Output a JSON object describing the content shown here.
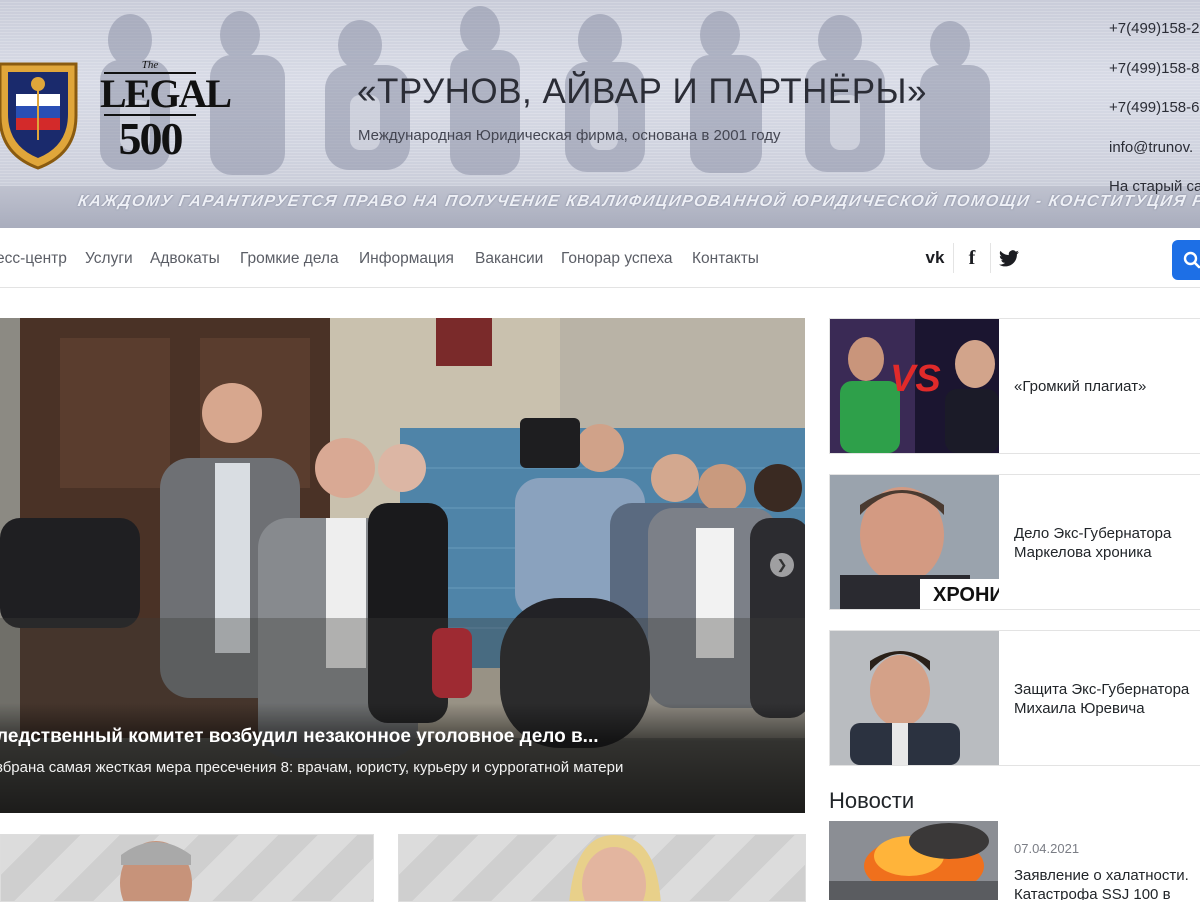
{
  "header": {
    "firm_name": "«ТРУНОВ, АЙВАР И ПАРТНЁРЫ»",
    "firm_subtitle": "Международная Юридическая фирма, основана в 2001 году",
    "motto": "КАЖДОМУ ГАРАНТИРУЕТСЯ ПРАВО НА ПОЛУЧЕНИЕ КВАЛИФИЦИРОВАННОЙ ЮРИДИЧЕСКОЙ ПОМОЩИ - КОНСТИТУЦИЯ РФ",
    "legal500": {
      "the": "The",
      "word": "LEGAL",
      "number": "500"
    },
    "contacts": [
      "+7(499)158-2",
      "+7(499)158-8",
      "+7(499)158-6",
      "info@trunov.",
      "На старый са"
    ]
  },
  "nav": {
    "items": [
      "есс-центр",
      "Услуги",
      "Адвокаты",
      "Громкие дела",
      "Информация",
      "Вакансии",
      "Гонорар успеха",
      "Контакты"
    ],
    "social": [
      "vk-icon",
      "facebook-icon",
      "twitter-icon"
    ],
    "social_glyphs": {
      "vk": "vk",
      "facebook": "f"
    }
  },
  "slider": {
    "title": "ледственный комитет возбудил незаконное уголовное дело в...",
    "text": "збрана самая жесткая мера пресечения 8: врачам, юристу, курьеру и суррогатной матери",
    "next_glyph": "❯"
  },
  "sidebar": {
    "cards": [
      {
        "title": "«Громкий плагиат»",
        "image_text": "VS"
      },
      {
        "title": "Дело Экс-Губернатора Маркелова хроника",
        "image_text": "ХРОНИ"
      },
      {
        "title": "Защита Экс-Губернатора Михаила Юревича"
      }
    ],
    "news_heading": "Новости",
    "news": [
      {
        "date": "07.04.2021",
        "title": "Заявление о халатности. Катастрофа SSJ 100 в"
      }
    ]
  },
  "colors": {
    "accent": "#1d6fe6",
    "text": "#212529",
    "nav_text": "#5b5e66"
  }
}
